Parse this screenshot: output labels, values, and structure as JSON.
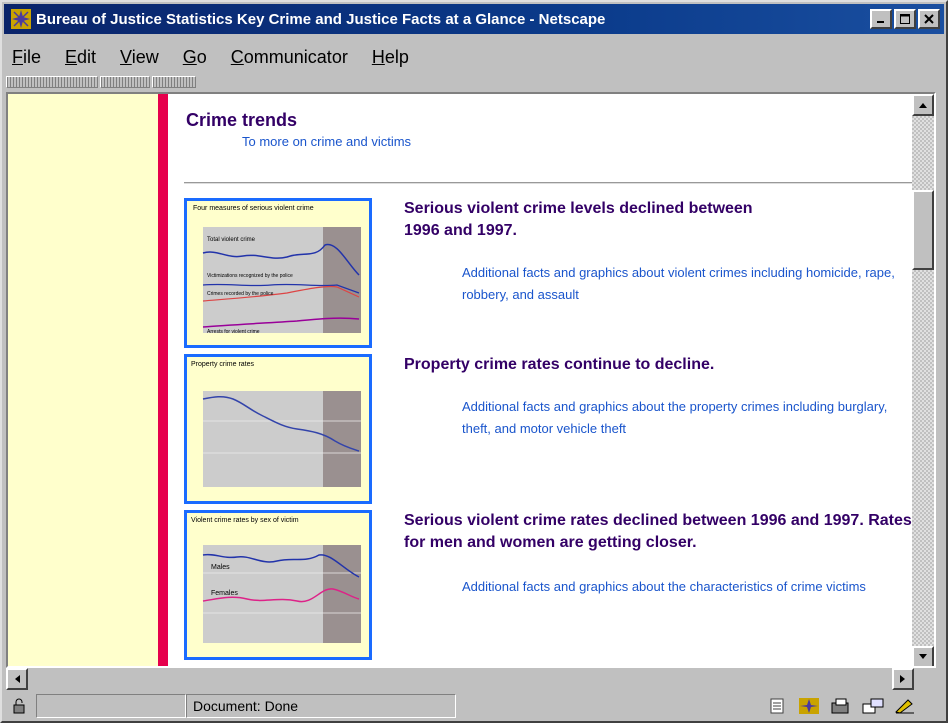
{
  "window": {
    "title": "Bureau of Justice Statistics Key Crime and Justice Facts at a Glance - Netscape",
    "controls": [
      "_",
      "□",
      "×"
    ]
  },
  "menu": [
    {
      "label": "File",
      "u": "F",
      "rest": "ile"
    },
    {
      "label": "Edit",
      "u": "E",
      "rest": "dit"
    },
    {
      "label": "View",
      "u": "V",
      "rest": "iew"
    },
    {
      "label": "Go",
      "u": "G",
      "rest": "o"
    },
    {
      "label": "Communicator",
      "u": "C",
      "rest": "ommunicator"
    },
    {
      "label": "Help",
      "u": "H",
      "rest": "elp"
    }
  ],
  "page": {
    "section_title": "Crime trends",
    "section_link": "To more on crime and victims",
    "items": [
      {
        "heading": "Serious violent crime levels declined between 1996 and 1997.",
        "link": "Additional facts and graphics about violent crimes including homicide, rape, robbery, and assault",
        "thumb_title": "Four measures of serious violent crime",
        "thumb_labels": [
          "Total violent crime",
          "Victimizations recognized by the police",
          "Crimes recorded by the police",
          "Arrests for violent crime"
        ]
      },
      {
        "heading": "Property crime rates continue to decline.",
        "link": "Additional facts and graphics about the property crimes including burglary, theft, and motor vehicle theft",
        "thumb_title": "Property crime rates",
        "thumb_labels": []
      },
      {
        "heading": "Serious violent crime rates declined between 1996 and 1997. Rates for men and women are getting closer.",
        "link": "Additional facts and graphics about the characteristics of crime victims",
        "thumb_title": "Violent crime rates by sex of victim",
        "thumb_labels": [
          "Males",
          "Females"
        ]
      }
    ]
  },
  "status": {
    "text": "Document: Done"
  },
  "colors": {
    "title_bar": "#0a246a",
    "sidebar": "#ffffcc",
    "accent_bar": "#e6004c",
    "heading": "#330066",
    "link": "#1a55cc",
    "thumb_border": "#1a6bff"
  }
}
